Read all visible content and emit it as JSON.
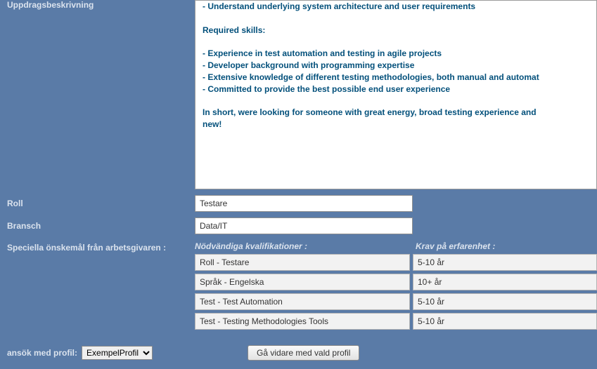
{
  "labels": {
    "uppdragsbeskrivning": "Uppdragsbeskrivning",
    "roll": "Roll",
    "bransch": "Bransch",
    "speciella": "Speciella önskemål från arbetsgivaren :",
    "nodvandiga": "Nödvändiga kvalifikationer :",
    "krav": "Krav på erfarenhet :",
    "ansok": "ansök med profil:",
    "go": "Gå vidare med vald profil"
  },
  "description": {
    "line1": "- Understand underlying system architecture and user requirements",
    "reqskills": "Required skills:",
    "r1": "- Experience in test automation and testing in agile projects",
    "r2": "- Developer background with programming expertise",
    "r3": "- Extensive knowledge of different testing methodologies, both manual and automat",
    "r4": "- Committed to provide the best possible end user experience",
    "inshort": "In short, were looking for someone with great energy, broad testing experience and",
    "new": "new!"
  },
  "fields": {
    "roll": "Testare",
    "bransch": "Data/IT"
  },
  "qualifications": [
    {
      "name": "Roll - Testare",
      "exp": "5-10 år"
    },
    {
      "name": "Språk - Engelska",
      "exp": "10+ år"
    },
    {
      "name": "Test - Test Automation",
      "exp": "5-10 år"
    },
    {
      "name": "Test - Testing Methodologies Tools",
      "exp": "5-10 år"
    }
  ],
  "profile_select": {
    "selected": "ExempelProfil"
  }
}
